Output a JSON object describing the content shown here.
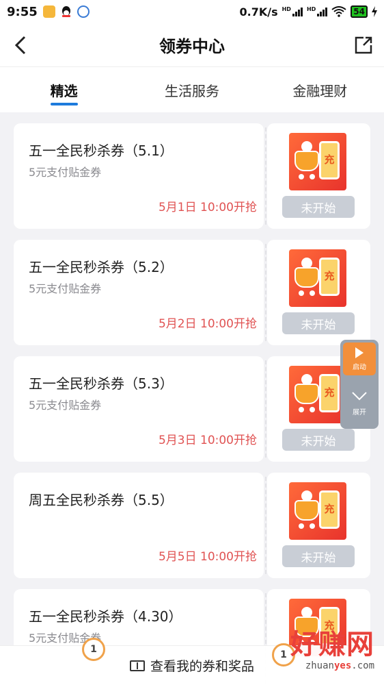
{
  "status_bar": {
    "time": "9:55",
    "net_speed": "0.7K/s",
    "battery": "54",
    "icons": [
      "notes-icon",
      "qq-icon",
      "app-icon",
      "signal-icon",
      "signal-icon",
      "wifi-icon",
      "battery-icon",
      "charging-icon"
    ]
  },
  "header": {
    "title": "领券中心",
    "back_icon": "chevron-left-icon",
    "share_icon": "share-icon"
  },
  "tabs": [
    {
      "label": "精选",
      "active": true
    },
    {
      "label": "生活服务",
      "active": false
    },
    {
      "label": "金融理财",
      "active": false
    }
  ],
  "coupons": [
    {
      "name": "五一全民秒杀券（5.1）",
      "desc": "5元支付贴金券",
      "time": "5月1日 10:00开抢",
      "status": "未开始",
      "image_text": "充"
    },
    {
      "name": "五一全民秒杀券（5.2）",
      "desc": "5元支付贴金券",
      "time": "5月2日 10:00开抢",
      "status": "未开始",
      "image_text": "充"
    },
    {
      "name": "五一全民秒杀券（5.3）",
      "desc": "5元支付贴金券",
      "time": "5月3日 10:00开抢",
      "status": "未开始",
      "image_text": "充"
    },
    {
      "name": "周五全民秒杀券（5.5）",
      "desc": "",
      "time": "5月5日 10:00开抢",
      "status": "未开始",
      "image_text": "充"
    },
    {
      "name": "五一全民秒杀券（4.30）",
      "desc": "5元支付贴金券",
      "time": "",
      "status": "",
      "image_text": "充"
    }
  ],
  "float_widget": {
    "start_label": "启动",
    "expand_label": "展开"
  },
  "bottom_bar": {
    "link_label": "查看我的券和奖品",
    "coin_left": "1",
    "coin_right": "1"
  },
  "watermark": {
    "text_cn": "好赚网",
    "url_prefix": "zhuan",
    "url_highlight": "yes",
    "url_suffix": ".com"
  },
  "colors": {
    "accent": "#1d7bdc",
    "time_red": "#e05252",
    "status_btn": "#c9ced6",
    "widget_orange": "#f28f3b"
  }
}
